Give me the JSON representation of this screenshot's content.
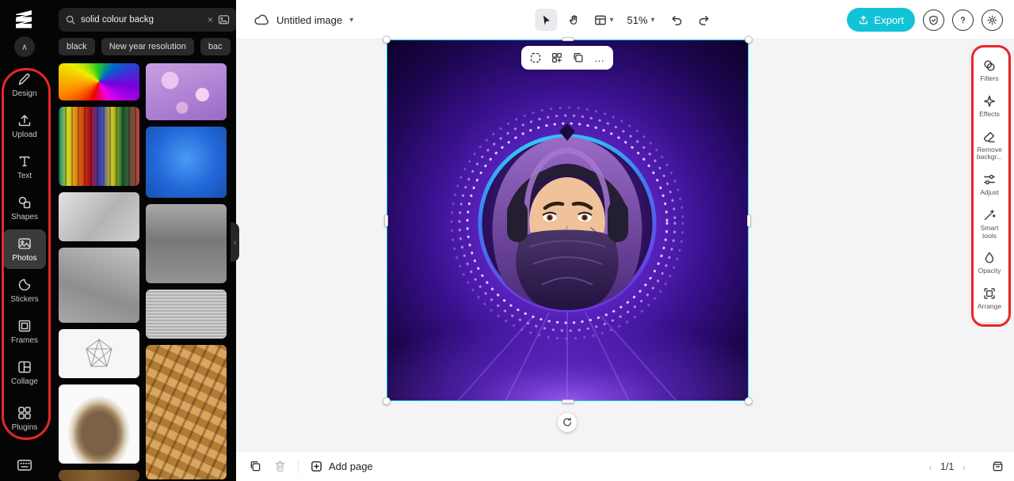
{
  "glyphs": {
    "chevron_down": "▾",
    "chevron_up": "∧",
    "more": "…",
    "clear": "×",
    "collapse_left": "‹",
    "page_prev": "‹",
    "page_next": "›"
  },
  "topbar": {
    "title": "Untitled image",
    "zoom": "51%",
    "export_label": "Export"
  },
  "left_nav": {
    "items": [
      {
        "label": "Design"
      },
      {
        "label": "Upload"
      },
      {
        "label": "Text"
      },
      {
        "label": "Shapes"
      },
      {
        "label": "Photos"
      },
      {
        "label": "Stickers"
      },
      {
        "label": "Frames"
      },
      {
        "label": "Collage"
      },
      {
        "label": "Plugins"
      }
    ]
  },
  "search": {
    "value": "solid colour backg",
    "chips": [
      "black",
      "New year resolution",
      "bac"
    ]
  },
  "photos": {
    "thumbnails": [
      "rainbow-spiral",
      "purple-butterflies",
      "abstract-paint",
      "blue-texture",
      "smooth-gray",
      "metal-plate",
      "concrete-texture",
      "brushed-metal",
      "wire-icosahedron",
      "wicker-weave",
      "stone",
      "wood-plank"
    ]
  },
  "right_panel": {
    "items": [
      {
        "label": "Filters"
      },
      {
        "label": "Effects"
      },
      {
        "label": "Remove backgr..."
      },
      {
        "label": "Adjust"
      },
      {
        "label": "Smart tools"
      },
      {
        "label": "Opacity"
      },
      {
        "label": "Arrange"
      }
    ]
  },
  "bottom_bar": {
    "add_page_label": "Add page",
    "page_indicator": "1/1"
  },
  "colors": {
    "accent": "#12c3d8",
    "selection": "#1ac8ea",
    "annotation": "#e8262a"
  }
}
